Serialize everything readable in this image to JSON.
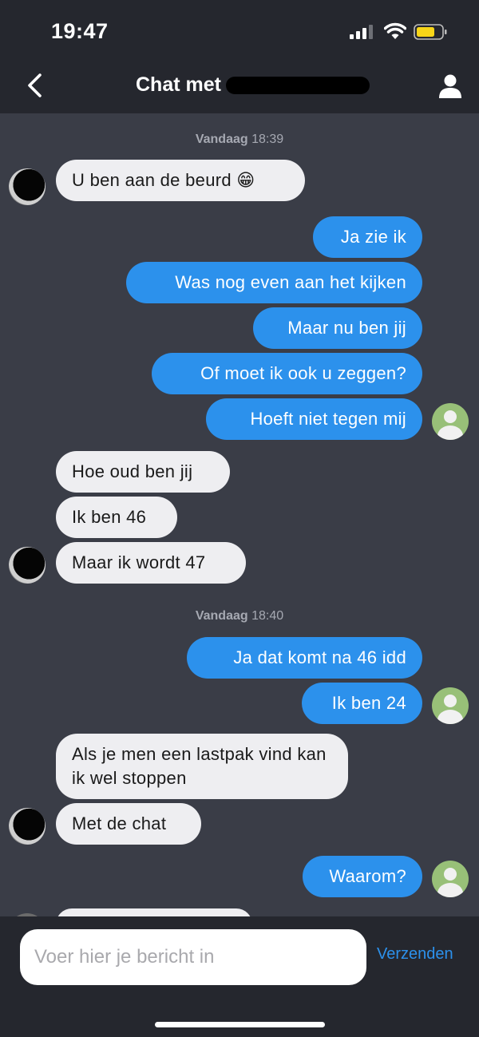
{
  "status_bar": {
    "time": "19:47",
    "icons": [
      "signal-icon",
      "wifi-icon",
      "battery-icon"
    ]
  },
  "header": {
    "title": "Chat met",
    "back_icon": "chevron-left-icon",
    "profile_icon": "user-icon"
  },
  "colors": {
    "background": "#3a3d47",
    "bars": "#25272e",
    "outgoing_bubble": "#2c91ec",
    "incoming_bubble": "#eeeef1",
    "battery": "#f7d518"
  },
  "messages": {
    "stamp1": {
      "day": "Vandaag",
      "time": "18:39"
    },
    "m1": "U ben aan de beurd 😁",
    "m2": "Ja zie ik",
    "m3": "Was nog even aan het kijken",
    "m4": "Maar nu ben jij",
    "m5": "Of moet ik ook u zeggen?",
    "m6": "Hoeft niet tegen mij",
    "m7": "Hoe oud ben jij",
    "m8": "Ik ben 46",
    "m9": "Maar ik wordt 47",
    "stamp2": {
      "day": "Vandaag",
      "time": "18:40"
    },
    "m10": "Ja dat komt na 46 idd",
    "m11": "Ik ben 24",
    "m12": "Als je men een lastpak  vind kan ik wel stoppen",
    "m13": "Met de chat",
    "m14": "Waarom?"
  },
  "composer": {
    "placeholder": "Voer hier je bericht in",
    "send_label": "Verzenden"
  }
}
